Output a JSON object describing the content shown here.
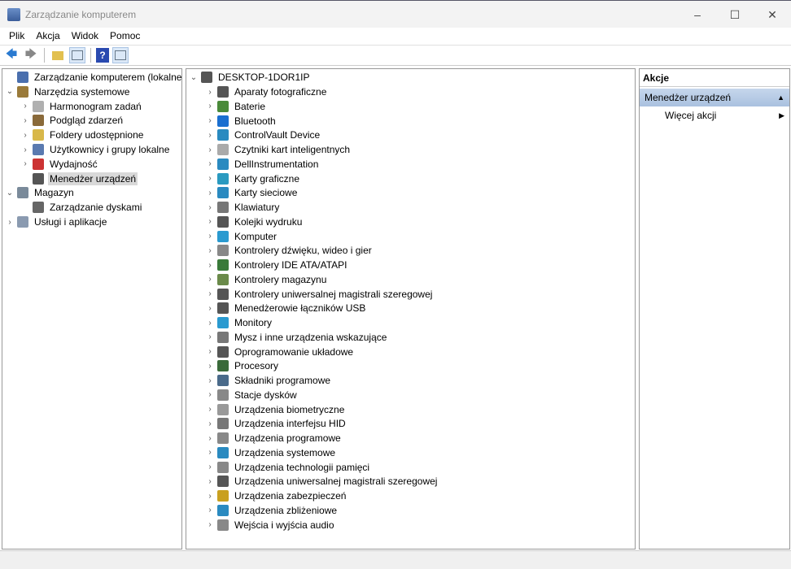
{
  "window": {
    "title": "Zarządzanie komputerem",
    "minimize": "–",
    "maximize": "☐",
    "close": "✕"
  },
  "menu": [
    "Plik",
    "Akcja",
    "Widok",
    "Pomoc"
  ],
  "toolbar": {
    "back": "🡄",
    "forward": "🡆",
    "help": "?"
  },
  "tree": [
    {
      "label": "Zarządzanie komputerem (lokalne)",
      "level": 0,
      "chev": "",
      "color": "#4a6fae"
    },
    {
      "label": "Narzędzia systemowe",
      "level": 0,
      "chev": "⌄",
      "color": "#9a7a3a"
    },
    {
      "label": "Harmonogram zadań",
      "level": 1,
      "chev": "›",
      "color": "#b0b0b0"
    },
    {
      "label": "Podgląd zdarzeń",
      "level": 1,
      "chev": "›",
      "color": "#8a6a3a"
    },
    {
      "label": "Foldery udostępnione",
      "level": 1,
      "chev": "›",
      "color": "#d8b84a"
    },
    {
      "label": "Użytkownicy i grupy lokalne",
      "level": 1,
      "chev": "›",
      "color": "#5a7ab0"
    },
    {
      "label": "Wydajność",
      "level": 1,
      "chev": "›",
      "color": "#c33"
    },
    {
      "label": "Menedżer urządzeń",
      "level": 1,
      "chev": "",
      "color": "#555",
      "selected": true
    },
    {
      "label": "Magazyn",
      "level": 0,
      "chev": "⌄",
      "color": "#7a8a9a"
    },
    {
      "label": "Zarządzanie dyskami",
      "level": 1,
      "chev": "",
      "color": "#666"
    },
    {
      "label": "Usługi i aplikacje",
      "level": 0,
      "chev": "›",
      "color": "#8a9ab0"
    }
  ],
  "devices": {
    "root": "DESKTOP-1DOR1IP",
    "items": [
      {
        "label": "Aparaty fotograficzne",
        "color": "#555"
      },
      {
        "label": "Baterie",
        "color": "#4a8a3a"
      },
      {
        "label": "Bluetooth",
        "color": "#1a6fd0"
      },
      {
        "label": "ControlVault Device",
        "color": "#2a8ac0"
      },
      {
        "label": "Czytniki kart inteligentnych",
        "color": "#aaa"
      },
      {
        "label": "DellInstrumentation",
        "color": "#2a8ac0"
      },
      {
        "label": "Karty graficzne",
        "color": "#2a9ac0"
      },
      {
        "label": "Karty sieciowe",
        "color": "#2a8ac0"
      },
      {
        "label": "Klawiatury",
        "color": "#777"
      },
      {
        "label": "Kolejki wydruku",
        "color": "#555"
      },
      {
        "label": "Komputer",
        "color": "#2a9ad0"
      },
      {
        "label": "Kontrolery dźwięku, wideo i gier",
        "color": "#888"
      },
      {
        "label": "Kontrolery IDE ATA/ATAPI",
        "color": "#3a7a3a"
      },
      {
        "label": "Kontrolery magazynu",
        "color": "#6a8a4a"
      },
      {
        "label": "Kontrolery uniwersalnej magistrali szeregowej",
        "color": "#555"
      },
      {
        "label": "Menedżerowie łączników USB",
        "color": "#555"
      },
      {
        "label": "Monitory",
        "color": "#2a9ad0"
      },
      {
        "label": "Mysz i inne urządzenia wskazujące",
        "color": "#777"
      },
      {
        "label": "Oprogramowanie układowe",
        "color": "#555"
      },
      {
        "label": "Procesory",
        "color": "#3a6a3a"
      },
      {
        "label": "Składniki programowe",
        "color": "#4a6a8a"
      },
      {
        "label": "Stacje dysków",
        "color": "#888"
      },
      {
        "label": "Urządzenia biometryczne",
        "color": "#999"
      },
      {
        "label": "Urządzenia interfejsu HID",
        "color": "#777"
      },
      {
        "label": "Urządzenia programowe",
        "color": "#888"
      },
      {
        "label": "Urządzenia systemowe",
        "color": "#2a8ac0"
      },
      {
        "label": "Urządzenia technologii pamięci",
        "color": "#888"
      },
      {
        "label": "Urządzenia uniwersalnej magistrali szeregowej",
        "color": "#555"
      },
      {
        "label": "Urządzenia zabezpieczeń",
        "color": "#c9a020"
      },
      {
        "label": "Urządzenia zbliżeniowe",
        "color": "#2a8ac0"
      },
      {
        "label": "Wejścia i wyjścia audio",
        "color": "#888"
      }
    ]
  },
  "actions": {
    "header": "Akcje",
    "section": "Menedżer urządzeń",
    "section_arrow": "▲",
    "item": "Więcej akcji",
    "item_arrow": "▶"
  }
}
